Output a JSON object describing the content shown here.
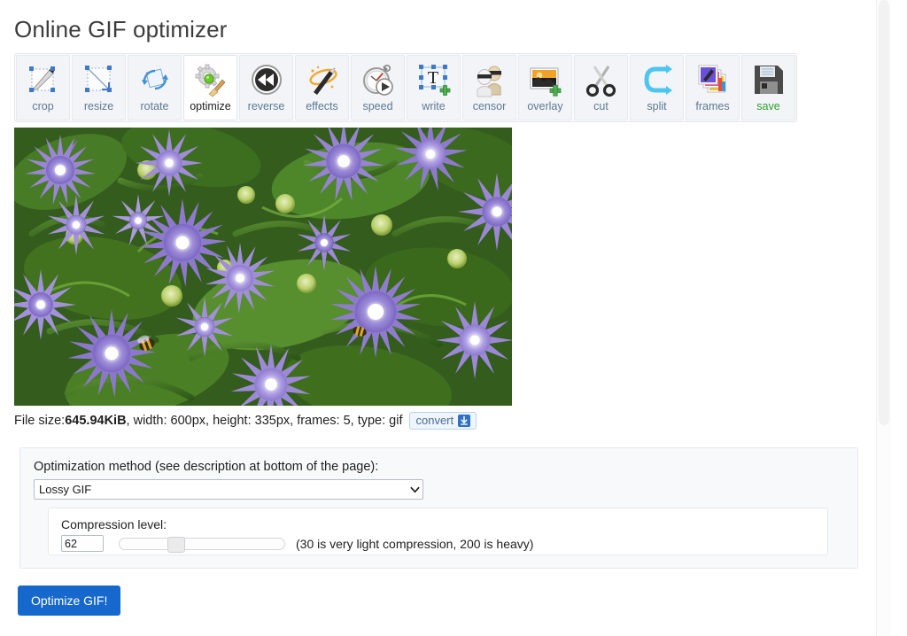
{
  "page": {
    "title": "Online GIF optimizer"
  },
  "toolbar": {
    "items": [
      {
        "label": "crop",
        "icon": "crop-icon",
        "active": false
      },
      {
        "label": "resize",
        "icon": "resize-icon",
        "active": false
      },
      {
        "label": "rotate",
        "icon": "rotate-icon",
        "active": false
      },
      {
        "label": "optimize",
        "icon": "optimize-icon",
        "active": true
      },
      {
        "label": "reverse",
        "icon": "reverse-icon",
        "active": false
      },
      {
        "label": "effects",
        "icon": "effects-icon",
        "active": false
      },
      {
        "label": "speed",
        "icon": "speed-icon",
        "active": false
      },
      {
        "label": "write",
        "icon": "write-icon",
        "active": false
      },
      {
        "label": "censor",
        "icon": "censor-icon",
        "active": false
      },
      {
        "label": "overlay",
        "icon": "overlay-icon",
        "active": false
      },
      {
        "label": "cut",
        "icon": "cut-icon",
        "active": false
      },
      {
        "label": "split",
        "icon": "split-icon",
        "active": false
      },
      {
        "label": "frames",
        "icon": "frames-icon",
        "active": false
      },
      {
        "label": "save",
        "icon": "save-icon",
        "active": false
      }
    ]
  },
  "preview": {
    "alt": "animated gif preview of purple stokes aster flowers"
  },
  "file_info": {
    "size_label": "File size: ",
    "size_value": "645.94KiB",
    "rest": ", width: 600px, height: 335px, frames: 5, type: gif",
    "convert_label": "convert",
    "convert_icon": "download-icon"
  },
  "optimization": {
    "method_label": "Optimization method (see description at bottom of the page):",
    "method_selected": "Lossy GIF",
    "method_options": [
      "Lossy GIF"
    ],
    "compression_label": "Compression level:",
    "compression_value": "62",
    "compression_hint": "(30 is very light compression, 200 is heavy)",
    "slider_min": 0,
    "slider_max": 200,
    "slider_percent": 33
  },
  "actions": {
    "submit_label": "Optimize GIF!"
  },
  "colors": {
    "accent_blue": "#1668cc",
    "tool_label": "#5e7a93",
    "save_label_green": "#2f9e2f",
    "panel_bg": "#f8f9fb"
  }
}
